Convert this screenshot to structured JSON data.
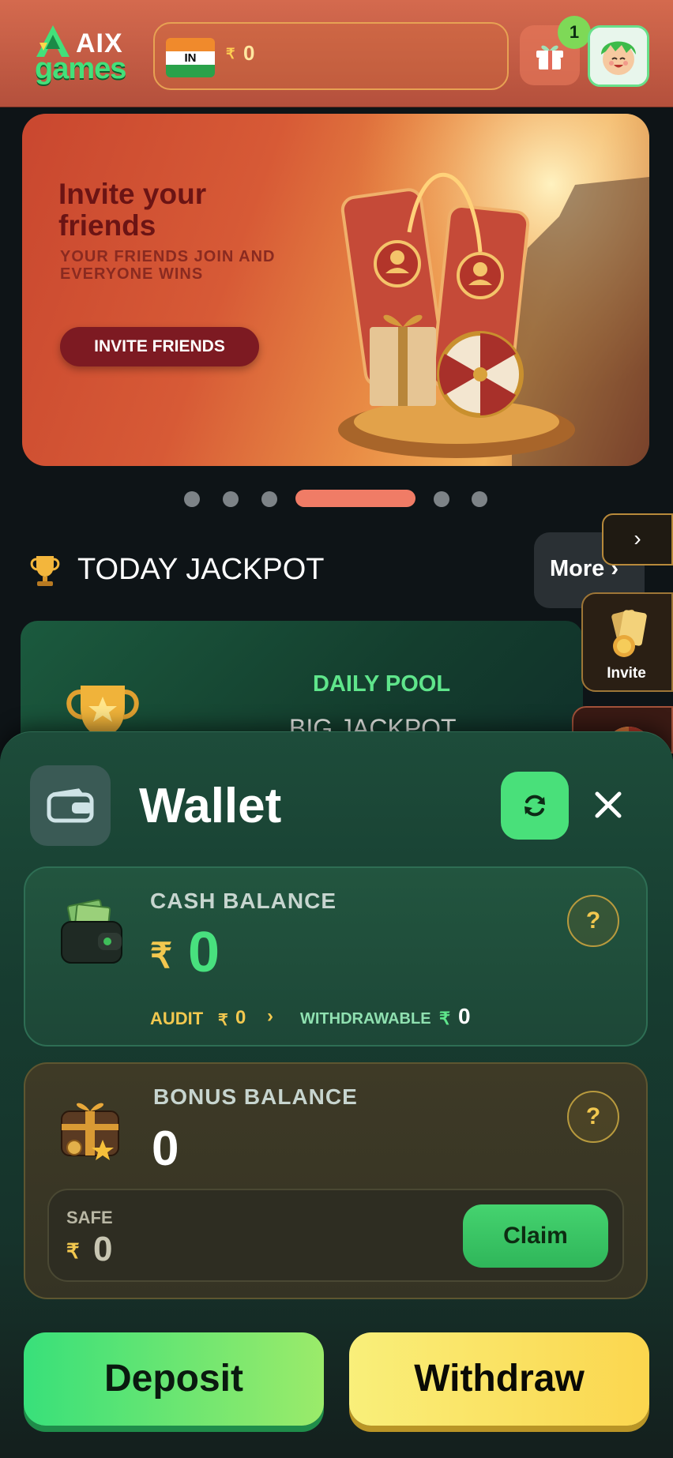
{
  "header": {
    "logo_top": "AIX",
    "logo_bottom": "games",
    "country_code": "IN",
    "currency_symbol": "₹",
    "balance": "0",
    "notification_count": "1"
  },
  "banner": {
    "title": "Invite your friends",
    "subtitle": "YOUR FRIENDS JOIN AND EVERYONE WINS",
    "button_label": "INVITE FRIENDS",
    "active_slide": 4,
    "slide_count": 7
  },
  "jackpot": {
    "title": "TODAY JACKPOT",
    "more_label": "More ›",
    "pool_label": "DAILY POOL",
    "pool_name": "BIG JACKPOT"
  },
  "side_menu": {
    "arrow": "›",
    "invite_label": "Invite"
  },
  "wallet": {
    "title": "Wallet",
    "cash": {
      "label": "CASH BALANCE",
      "currency": "₹",
      "value": "0",
      "audit_label": "AUDIT",
      "audit_currency": "₹",
      "audit_value": "0",
      "audit_chevron": "›",
      "withdrawable_label": "WITHDRAWABLE",
      "withdrawable_currency": "₹",
      "withdrawable_value": "0",
      "help": "?"
    },
    "bonus": {
      "label": "BONUS BALANCE",
      "value": "0",
      "help": "?",
      "safe_label": "SAFE",
      "safe_currency": "₹",
      "safe_value": "0",
      "claim_label": "Claim"
    },
    "deposit_label": "Deposit",
    "withdraw_label": "Withdraw"
  },
  "colors": {
    "header_bg": "#c85a43",
    "accent_green": "#48e07e",
    "accent_gold": "#f2c84f",
    "withdraw_yellow": "#fbe05e"
  }
}
